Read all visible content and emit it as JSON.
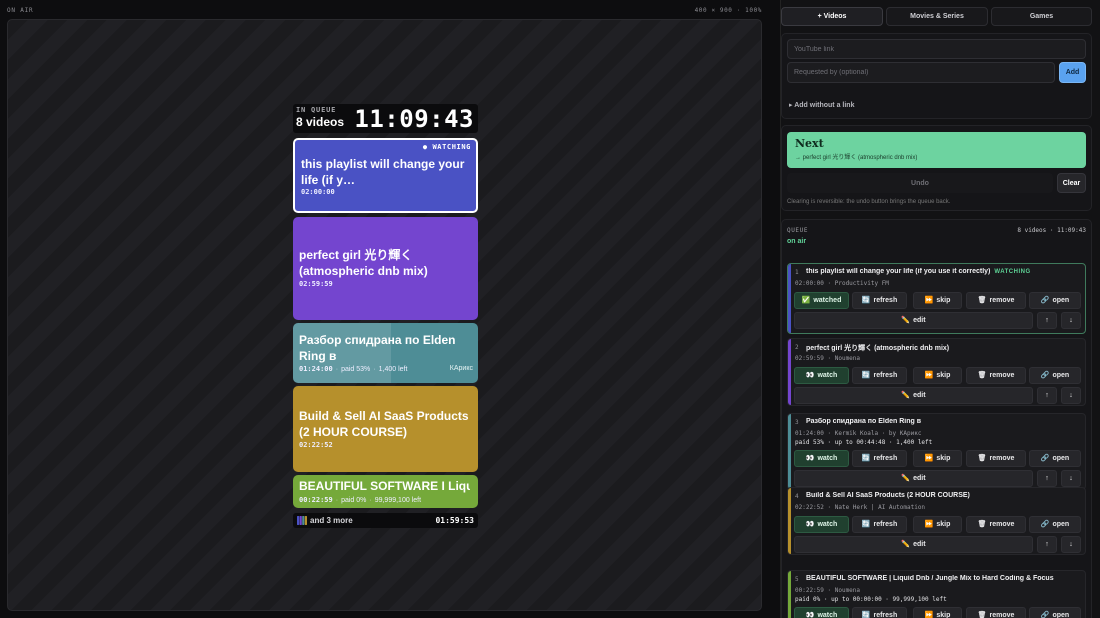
{
  "stage": {
    "top_left": "ON AIR",
    "top_right": "400 × 900 · 100%"
  },
  "overlay": {
    "label": "IN QUEUE",
    "count": "8 videos",
    "clock": "11:09:43",
    "cards": [
      {
        "title": "this playlist will change your life (if y…",
        "duration": "02:00:00",
        "badge": "● WATCHING",
        "color": "#4a52c4"
      },
      {
        "title": "perfect girl 光り輝く (atmospheric dnb mix)",
        "duration": "02:59:59",
        "color": "#7445cf"
      },
      {
        "title": "Разбор спидрана по Elden Ring в",
        "duration": "01:24:00",
        "paid": "paid 53%",
        "left": "1,400 left",
        "by": "КАрикс",
        "paid_fraction": 0.53,
        "color": "#4e8d96"
      },
      {
        "title": "Build & Sell AI SaaS Products (2 HOUR COURSE)",
        "duration": "02:22:52",
        "color": "#b6902c"
      },
      {
        "title": "BEAUTIFUL SOFTWARE I Liquid…",
        "duration": "00:22:59",
        "paid": "paid 0%",
        "left": "99,999,100 left",
        "paid_fraction": 0.0,
        "color": "#75a93a"
      }
    ],
    "more": "and 3 more",
    "total": "01:59:53",
    "more_colors": [
      "#4a52c4",
      "#7445cf",
      "#4e8d96",
      "#b6902c"
    ]
  },
  "tabs": [
    {
      "label": "+ Videos",
      "active": true
    },
    {
      "label": "Movies & Series",
      "active": false
    },
    {
      "label": "Games",
      "active": false
    }
  ],
  "add_form": {
    "link_placeholder": "YouTube link",
    "requester_placeholder": "Requested by (optional)",
    "add_label": "Add",
    "nolink_label": "▸ Add without a link"
  },
  "next": {
    "label": "Next",
    "subtitle": "→ perfect girl 光り輝く (atmospheric dnb mix)",
    "undo_label": "Undo",
    "clear_label": "Clear",
    "note": "Clearing is reversible: the undo button brings the queue back."
  },
  "queue": {
    "label": "QUEUE",
    "summary": "8 videos · 11:09:43",
    "on_air": "on air",
    "buttons": {
      "watched": "watched",
      "watch": "watch",
      "refresh": "refresh",
      "skip": "skip",
      "remove": "remove",
      "open": "open",
      "edit": "edit",
      "up": "↑",
      "down": "↓"
    },
    "items": [
      {
        "num": "1",
        "title": "this playlist will change your life (if you use it correctly)",
        "watching": "WATCHING",
        "meta": "02:00:00 · Productivity FM",
        "color": "#4a52c4",
        "current": true
      },
      {
        "num": "2",
        "title": "perfect girl 光り輝く (atmospheric dnb mix)",
        "meta": "02:59:59 · Noumena",
        "color": "#7445cf"
      },
      {
        "num": "3",
        "title": "Разбор спидрана по Elden Ring в",
        "meta": "01:24:00 · Kermik Koala · by КАрикс",
        "paid": "paid 53% · up to 00:44:48 · 1,400 left",
        "color": "#4e8d96"
      },
      {
        "num": "4",
        "title": "Build & Sell AI SaaS Products (2 HOUR COURSE)",
        "meta": "02:22:52 · Nate Herk | AI Automation",
        "color": "#b6902c"
      },
      {
        "num": "5",
        "title": "BEAUTIFUL SOFTWARE | Liquid Dnb / Jungle Mix to Hard Coding & Focus",
        "meta": "00:22:59 · Noumena",
        "paid": "paid 0% · up to 00:00:00 · 99,999,100 left",
        "color": "#75a93a"
      }
    ]
  }
}
